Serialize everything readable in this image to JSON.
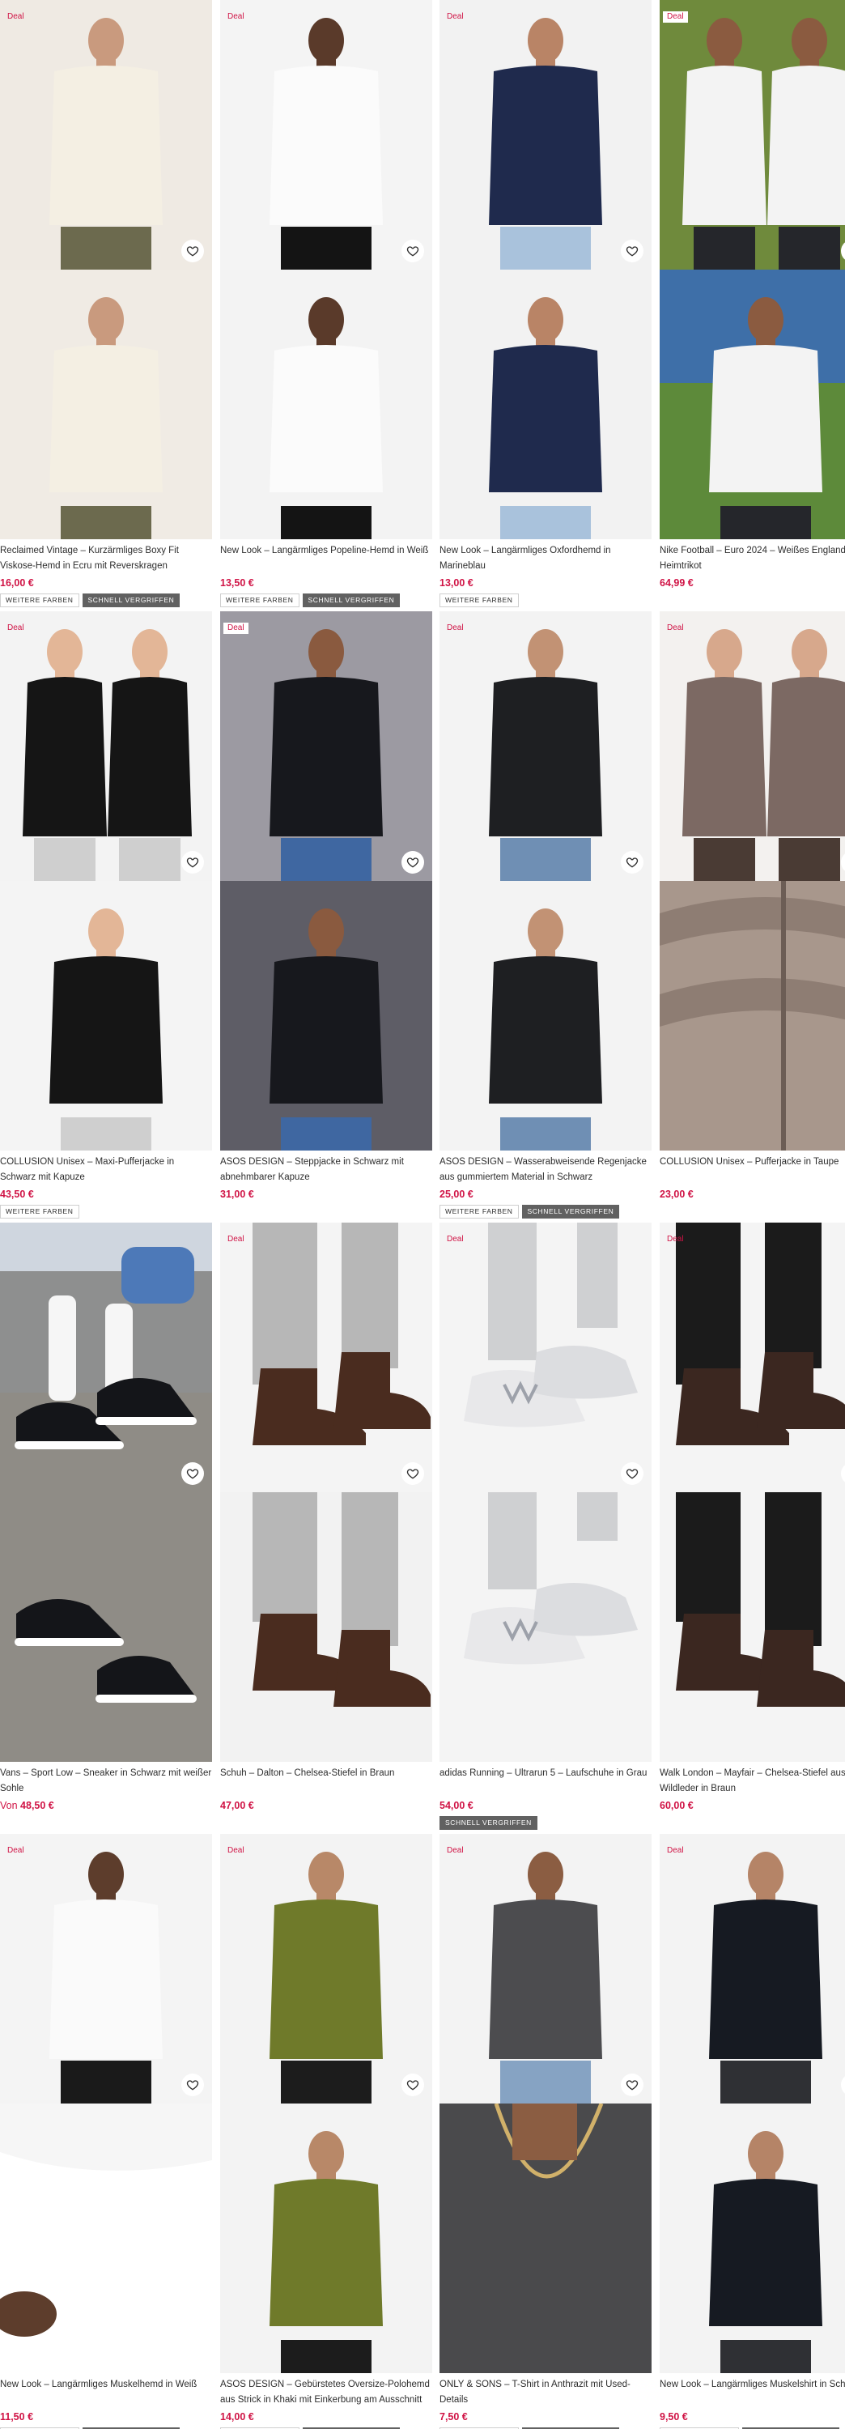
{
  "deal_label": "Deal",
  "products": [
    {
      "title": "Reclaimed Vintage – Kurzärmliges Boxy Fit Viskose-Hemd in Ecru mit Reverskragen",
      "price": "16,00 €",
      "price_prefix": "",
      "badges": [
        "WEITERE FARBEN",
        "SCHNELL VERGRIFFEN"
      ],
      "deal": true,
      "colors": {
        "bg_a": "#efeae3",
        "bg_b": "#f0ebe4",
        "item": "#f4efe3",
        "bottom": "#6c6a4e",
        "skin": "#c99a7e"
      }
    },
    {
      "title": "New Look – Langärmliges Popeline-Hemd in Weiß",
      "price": "13,50 €",
      "price_prefix": "",
      "badges": [
        "WEITERE FARBEN",
        "SCHNELL VERGRIFFEN"
      ],
      "deal": true,
      "colors": {
        "bg_a": "#f4f4f4",
        "bg_b": "#f3f3f3",
        "item": "#fbfbfb",
        "bottom": "#141414",
        "skin": "#5a3a2a"
      }
    },
    {
      "title": "New Look – Langärmliges Oxfordhemd in Marineblau",
      "price": "13,00 €",
      "price_prefix": "",
      "badges": [
        "WEITERE FARBEN"
      ],
      "deal": true,
      "colors": {
        "bg_a": "#f2f2f2",
        "bg_b": "#f2f2f2",
        "item": "#1f2a4d",
        "bottom": "#a9c2dc",
        "skin": "#b98466"
      }
    },
    {
      "title": "Nike Football – Euro 2024 – Weißes England-Heimtrikot",
      "price": "64,99 €",
      "price_prefix": "",
      "badges": [],
      "deal": true,
      "colors": {
        "bg_a": "#6f8a3c",
        "bg_b": "#5d7a3a",
        "item": "#f3f3f3",
        "bottom": "#25262b",
        "skin": "#8b5b40"
      }
    },
    {
      "title": "COLLUSION Unisex – Maxi-Pufferjacke in Schwarz mit Kapuze",
      "price": "43,50 €",
      "price_prefix": "",
      "badges": [
        "WEITERE FARBEN"
      ],
      "deal": true,
      "colors": {
        "bg_a": "#f3f3f3",
        "bg_b": "#f4f4f4",
        "item": "#151515",
        "bottom": "#cfcfcf",
        "skin": "#e3b697"
      }
    },
    {
      "title": "ASOS DESIGN – Steppjacke in Schwarz mit abnehmbarer Kapuze",
      "price": "31,00 €",
      "price_prefix": "",
      "badges": [],
      "deal": true,
      "colors": {
        "bg_a": "#9c9aa2",
        "bg_b": "#5e5d66",
        "item": "#17181d",
        "bottom": "#3f67a1",
        "skin": "#8a5a3f"
      }
    },
    {
      "title": "ASOS DESIGN – Wasserabweisende Regenjacke aus gummiertem Material in Schwarz",
      "price": "25,00 €",
      "price_prefix": "",
      "badges": [
        "WEITERE FARBEN",
        "SCHNELL VERGRIFFEN"
      ],
      "deal": true,
      "colors": {
        "bg_a": "#f3f3f3",
        "bg_b": "#f3f3f3",
        "item": "#1e1f22",
        "bottom": "#6f8fb4",
        "skin": "#c29274"
      }
    },
    {
      "title": "COLLUSION Unisex – Pufferjacke in Taupe",
      "price": "23,00 €",
      "price_prefix": "",
      "badges": [],
      "deal": true,
      "colors": {
        "bg_a": "#f3f1ef",
        "bg_b": "#b8a89e",
        "item": "#7c6963",
        "bottom": "#4a3b34",
        "skin": "#d7a88c"
      }
    },
    {
      "title": "Vans – Sport Low – Sneaker in Schwarz mit weißer Sohle",
      "price": "48,50 €",
      "price_prefix": "Von",
      "badges": [],
      "deal": false,
      "colors": {
        "bg_a": "#8e8f8f",
        "bg_b": "#6b6c6e",
        "item": "#141519",
        "bottom": "#ffffff",
        "skin": "#4d79b8"
      }
    },
    {
      "title": "Schuh – Dalton – Chelsea-Stiefel in Braun",
      "price": "47,00 €",
      "price_prefix": "",
      "badges": [],
      "deal": true,
      "colors": {
        "bg_a": "#f4f4f4",
        "bg_b": "#f2f2f2",
        "item": "#4a2c1f",
        "bottom": "#b7b7b7",
        "skin": "#cfcfcf"
      }
    },
    {
      "title": "adidas Running – Ultrarun 5 – Laufschuhe in Grau",
      "price": "54,00 €",
      "price_prefix": "",
      "badges": [
        "SCHNELL VERGRIFFEN"
      ],
      "deal": true,
      "colors": {
        "bg_a": "#f4f4f4",
        "bg_b": "#f4f4f4",
        "item": "#e8e8ea",
        "bottom": "#b9bcc4",
        "skin": "#d0d0d0"
      }
    },
    {
      "title": "Walk London – Mayfair – Chelsea-Stiefel aus Wildleder in Braun",
      "price": "60,00 €",
      "price_prefix": "",
      "badges": [],
      "deal": true,
      "colors": {
        "bg_a": "#f4f4f4",
        "bg_b": "#f4f4f4",
        "item": "#3b2720",
        "bottom": "#1b1b1b",
        "skin": "#1b1b1b"
      }
    },
    {
      "title": "New Look – Langärmliges Muskelhemd in Weiß",
      "price": "11,50 €",
      "price_prefix": "",
      "badges": [
        "WEITERE FARBEN",
        "SCHNELL VERGRIFFEN"
      ],
      "deal": true,
      "colors": {
        "bg_a": "#f4f4f4",
        "bg_b": "#f1f1f1",
        "item": "#fafafa",
        "bottom": "#1a1a1a",
        "skin": "#5d3d2c"
      }
    },
    {
      "title": "ASOS DESIGN – Gebürstetes Oversize-Polohemd aus Strick in Khaki mit Einkerbung am Ausschnitt",
      "price": "14,00 €",
      "price_prefix": "",
      "badges": [
        "WEITERE FARBEN",
        "SCHNELL VERGRIFFEN"
      ],
      "deal": true,
      "colors": {
        "bg_a": "#f3f3f3",
        "bg_b": "#f3f3f3",
        "item": "#6f7a2a",
        "bottom": "#1c1c1c",
        "skin": "#b88868"
      }
    },
    {
      "title": "ONLY & SONS – T-Shirt in Anthrazit mit Used-Details",
      "price": "7,50 €",
      "price_prefix": "",
      "badges": [
        "WEITERE FARBEN",
        "SCHNELL VERGRIFFEN"
      ],
      "deal": true,
      "colors": {
        "bg_a": "#f3f3f3",
        "bg_b": "#4a4a4c",
        "item": "#4c4c4f",
        "bottom": "#86a3c3",
        "skin": "#8b5d42"
      }
    },
    {
      "title": "New Look – Langärmliges Muskelshirt in Schwarz",
      "price": "9,50 €",
      "price_prefix": "",
      "badges": [
        "WEITERE FARBEN",
        "SCHNELL VERGRIFFEN"
      ],
      "deal": true,
      "colors": {
        "bg_a": "#f3f3f3",
        "bg_b": "#f3f3f3",
        "item": "#161a22",
        "bottom": "#2f3034",
        "skin": "#b58467"
      }
    }
  ]
}
